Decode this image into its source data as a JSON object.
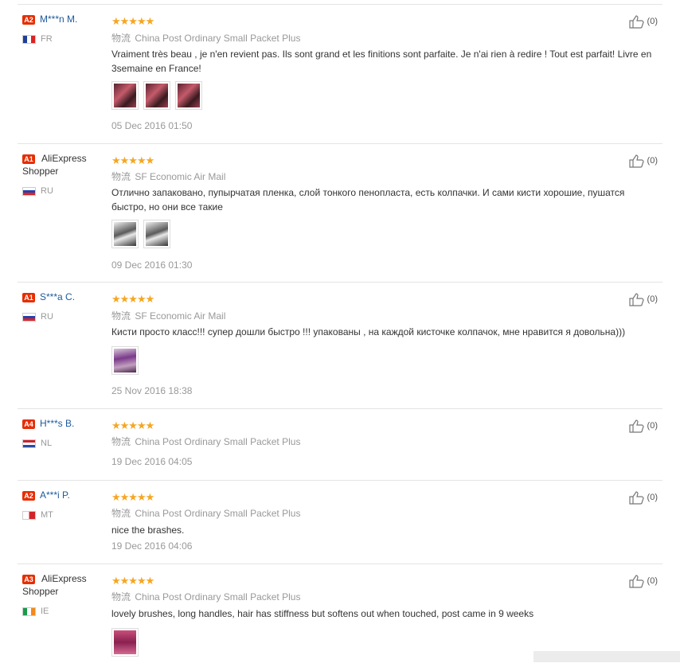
{
  "reviews": [
    {
      "badge": "A2",
      "user": "M***n M.",
      "country": "FR",
      "flag": "fr",
      "stars": "★★★★★",
      "shipping_cn": "物流",
      "shipping": "China Post Ordinary Small Packet Plus",
      "text": "Vraiment très beau , je n'en revient pas. Ils sont grand et les finitions sont parfaite. Je n'ai rien à redire ! Tout est parfait! Livre en 3semaine en France!",
      "photos": 3,
      "date": "05 Dec 2016 01:50",
      "likes": "(0)"
    },
    {
      "badge": "A1",
      "user": "AliExpress Shopper",
      "country": "RU",
      "flag": "ru",
      "stars": "★★★★★",
      "shipping_cn": "物流",
      "shipping": "SF Economic Air Mail",
      "text": "Отлично запаковано, пупырчатая пленка, слой тонкого пенопласта, есть колпачки. И сами кисти хорошие, пушатся быстро, но они все такие",
      "photos": 2,
      "date": "09 Dec 2016 01:30",
      "likes": "(0)"
    },
    {
      "badge": "A1",
      "user": "S***a C.",
      "country": "RU",
      "flag": "ru",
      "stars": "★★★★★",
      "shipping_cn": "物流",
      "shipping": "SF Economic Air Mail",
      "text": "Кисти просто класс!!! супер дошли быстро !!! упакованы , на каждой кисточке колпачок, мне нравится я довольна)))",
      "photos": 1,
      "date": "25 Nov 2016 18:38",
      "likes": "(0)"
    },
    {
      "badge": "A4",
      "user": "H***s B.",
      "country": "NL",
      "flag": "nl",
      "stars": "★★★★★",
      "shipping_cn": "物流",
      "shipping": "China Post Ordinary Small Packet Plus",
      "text": "",
      "photos": 0,
      "date": "19 Dec 2016 04:05",
      "likes": "(0)"
    },
    {
      "badge": "A2",
      "user": "A***i P.",
      "country": "MT",
      "flag": "mt",
      "stars": "★★★★★",
      "shipping_cn": "物流",
      "shipping": "China Post Ordinary Small Packet Plus",
      "text": "nice the brashes.",
      "photos": 0,
      "date": "19 Dec 2016 04:06",
      "likes": "(0)"
    },
    {
      "badge": "A3",
      "user": "AliExpress Shopper",
      "country": "IE",
      "flag": "ie",
      "stars": "★★★★★",
      "shipping_cn": "物流",
      "shipping": "China Post Ordinary Small Packet Plus",
      "text": "lovely brushes, long handles, hair has stiffness but softens out when touched, post came in 9 weeks",
      "photos": 1,
      "date": "",
      "likes": "(0)"
    }
  ]
}
